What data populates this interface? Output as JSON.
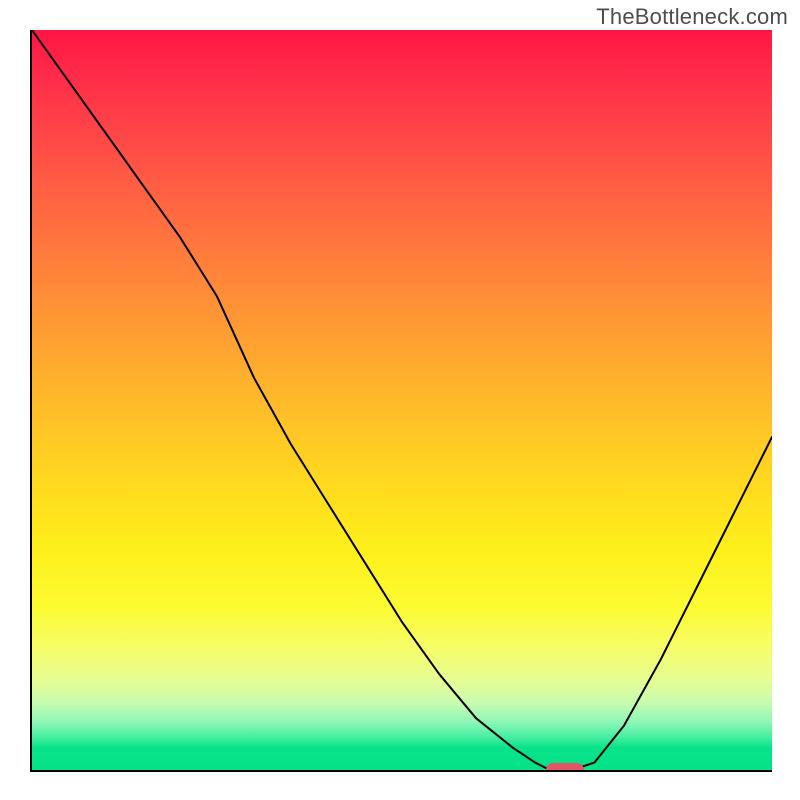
{
  "attribution": "TheBottleneck.com",
  "chart_data": {
    "type": "line",
    "title": "",
    "xlabel": "",
    "ylabel": "",
    "xlim": [
      0,
      100
    ],
    "ylim": [
      0,
      100
    ],
    "grid": false,
    "legend": false,
    "background_gradient": {
      "orientation": "vertical",
      "stops": [
        {
          "pos": 0.0,
          "color": "#ff1545"
        },
        {
          "pos": 0.5,
          "color": "#ffb32a"
        },
        {
          "pos": 0.8,
          "color": "#fbfb45"
        },
        {
          "pos": 1.0,
          "color": "#04e287"
        }
      ]
    },
    "marker": {
      "x": 72,
      "color": "#e25563"
    },
    "series": [
      {
        "name": "curve",
        "x": [
          0,
          5,
          10,
          15,
          20,
          25,
          30,
          35,
          40,
          45,
          50,
          55,
          60,
          65,
          68,
          70,
          73,
          76,
          80,
          85,
          90,
          95,
          100
        ],
        "y": [
          100,
          93,
          86,
          79,
          72,
          64,
          53,
          44,
          36,
          28,
          20,
          13,
          7,
          3,
          1,
          0,
          0,
          1,
          6,
          15,
          25,
          35,
          45
        ]
      }
    ]
  }
}
